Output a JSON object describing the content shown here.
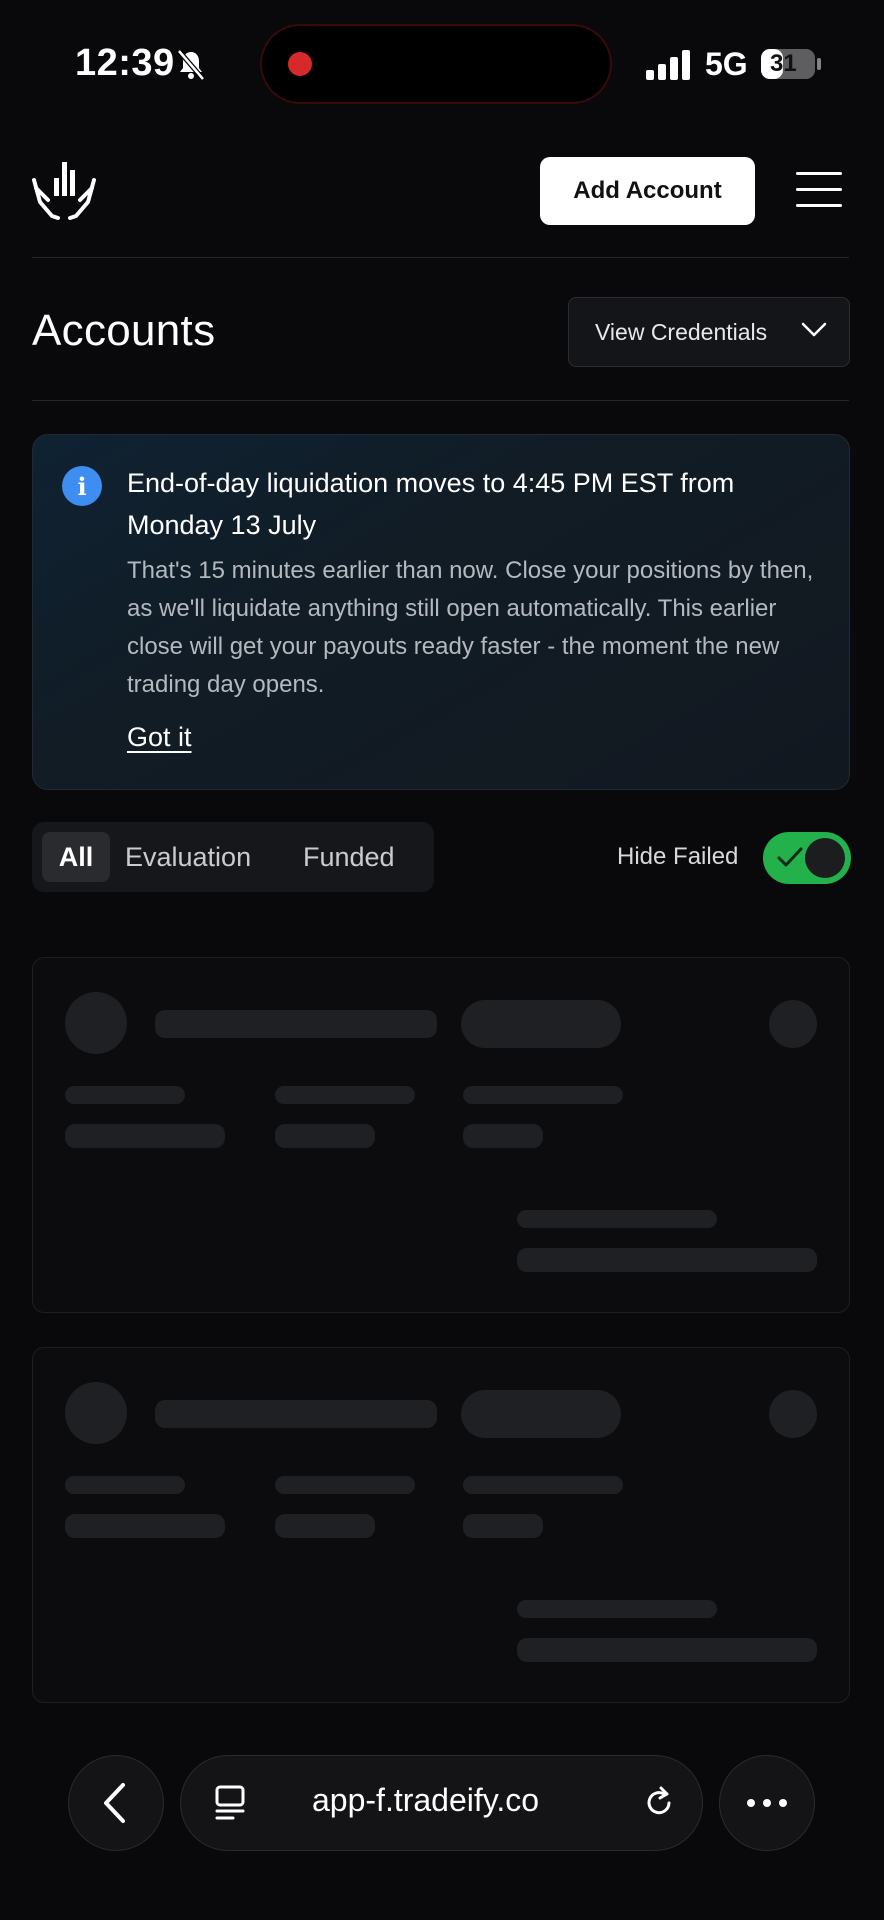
{
  "status_bar": {
    "time": "12:39",
    "network": "5G",
    "battery": "31"
  },
  "header": {
    "add_account": "Add Account"
  },
  "page": {
    "title": "Accounts",
    "credentials_button": "View Credentials"
  },
  "notice": {
    "title": "End-of-day liquidation moves to 4:45 PM EST from Monday 13 July",
    "body": "That's 15 minutes earlier than now. Close your positions by then, as we'll liquidate anything still open automatically. This earlier close will get your payouts ready faster - the moment the new trading day opens.",
    "action": "Got it"
  },
  "filters": {
    "tabs": [
      {
        "label": "All"
      },
      {
        "label": "Evaluation"
      },
      {
        "label": "Funded"
      }
    ],
    "hide_failed_label": "Hide Failed",
    "hide_failed_on": true
  },
  "browser": {
    "url": "app-f.tradeify.co"
  },
  "colors": {
    "accent_toggle": "#22b14a",
    "info": "#3d8ef0",
    "background": "#09090b"
  }
}
